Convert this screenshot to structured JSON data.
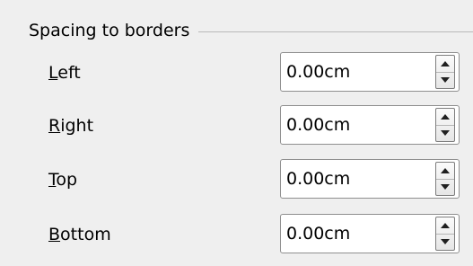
{
  "group": {
    "title": "Spacing to borders"
  },
  "fields": [
    {
      "mnemonic": "L",
      "rest": "eft",
      "value": "0.00cm"
    },
    {
      "mnemonic": "R",
      "rest": "ight",
      "value": "0.00cm"
    },
    {
      "mnemonic": "T",
      "rest": "op",
      "value": "0.00cm"
    },
    {
      "mnemonic": "B",
      "rest": "ottom",
      "value": "0.00cm"
    }
  ],
  "icons": {
    "increment": "arrow-up-icon",
    "decrement": "arrow-down-icon"
  }
}
